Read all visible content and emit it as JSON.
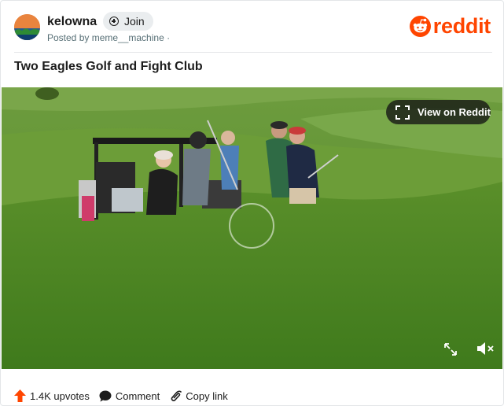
{
  "header": {
    "subreddit": "kelowna",
    "join_label": "Join",
    "posted_by": "Posted by meme__machine ·",
    "logo_text": "reddit"
  },
  "post": {
    "title": "Two Eagles Golf and Fight Club"
  },
  "video": {
    "view_label": "View on Reddit"
  },
  "footer": {
    "upvotes": "1.4K upvotes",
    "comment_label": "Comment",
    "copy_label": "Copy link"
  },
  "colors": {
    "brand": "#ff4500",
    "join_bg": "#eaedef",
    "muted_text": "#576f76"
  },
  "icons": [
    "subreddit-avatar",
    "plus-circle-icon",
    "reddit-snoo-icon",
    "fullscreen-icon",
    "expand-icon",
    "mute-icon",
    "upvote-arrow-icon",
    "comment-bubble-icon",
    "link-icon"
  ]
}
